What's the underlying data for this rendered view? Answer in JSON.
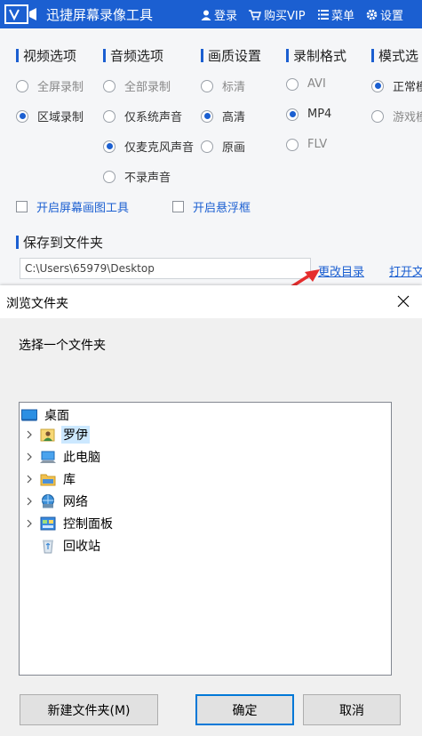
{
  "app": {
    "title": "迅捷屏幕录像工具",
    "menu": {
      "login": "登录",
      "buy_vip": "购买VIP",
      "menu": "菜单",
      "settings": "设置"
    },
    "accent_color": "#1b5fd1"
  },
  "sections": {
    "video": {
      "title": "视频选项",
      "options": [
        "全屏录制",
        "区域录制"
      ],
      "selected": "区域录制"
    },
    "audio": {
      "title": "音频选项",
      "options": [
        "全部录制",
        "仅系统声音",
        "仅麦克风声音",
        "不录声音"
      ],
      "selected": "仅麦克风声音"
    },
    "quality": {
      "title": "画质设置",
      "options": [
        "标清",
        "高清",
        "原画"
      ],
      "selected": "高清"
    },
    "format": {
      "title": "录制格式",
      "options": [
        "AVI",
        "MP4",
        "FLV"
      ],
      "selected": "MP4"
    },
    "mode": {
      "title": "模式选",
      "options": [
        "正常模",
        "游戏模"
      ],
      "selected": "正常模"
    }
  },
  "toggles": {
    "screen_paint": "开启屏幕画图工具",
    "float_frame": "开启悬浮框"
  },
  "save": {
    "title": "保存到文件夹",
    "path": "C:\\Users\\65979\\Desktop",
    "change_dir": "更改目录",
    "open_dir": "打开文"
  },
  "dialog": {
    "title": "浏览文件夹",
    "prompt": "选择一个文件夹",
    "tree": [
      {
        "label": "桌面",
        "icon": "desktop-icon",
        "expandable": false,
        "selected": false
      },
      {
        "label": "罗伊",
        "icon": "user-folder-icon",
        "expandable": true,
        "selected": true
      },
      {
        "label": "此电脑",
        "icon": "computer-icon",
        "expandable": true,
        "selected": false
      },
      {
        "label": "库",
        "icon": "library-icon",
        "expandable": true,
        "selected": false
      },
      {
        "label": "网络",
        "icon": "network-icon",
        "expandable": true,
        "selected": false
      },
      {
        "label": "控制面板",
        "icon": "control-panel-icon",
        "expandable": true,
        "selected": false
      },
      {
        "label": "回收站",
        "icon": "recycle-bin-icon",
        "expandable": false,
        "selected": false
      }
    ],
    "buttons": {
      "new_folder": "新建文件夹(M)",
      "ok": "确定",
      "cancel": "取消"
    }
  }
}
